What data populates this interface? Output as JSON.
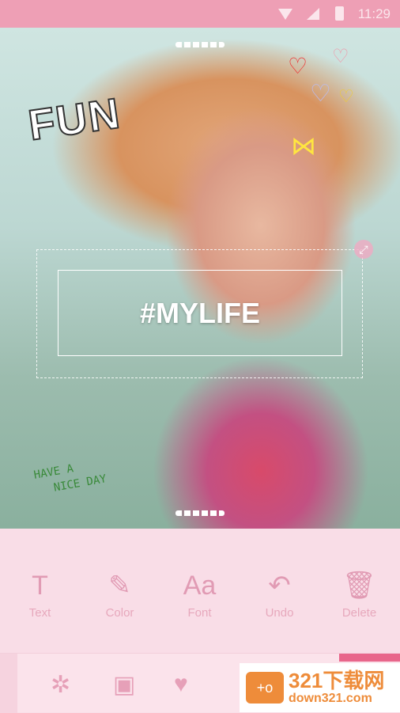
{
  "status_bar": {
    "time": "11:29",
    "icons": [
      "wifi-icon",
      "signal-icon",
      "battery-icon"
    ]
  },
  "canvas": {
    "text_overlay": "#MYLIFE",
    "sticker_fun": "FUN",
    "sticker_nice_day_line1": "HAVE A",
    "sticker_nice_day_line2": "NICE DAY"
  },
  "toolbar": {
    "items": [
      {
        "label": "Text",
        "icon": "text-icon",
        "glyph": "T"
      },
      {
        "label": "Color",
        "icon": "eyedropper-icon",
        "glyph": "✎"
      },
      {
        "label": "Font",
        "icon": "font-icon",
        "glyph": "Aa"
      },
      {
        "label": "Undo",
        "icon": "undo-icon",
        "glyph": "↶"
      },
      {
        "label": "Delete",
        "icon": "trash-icon",
        "glyph": "🗑"
      }
    ]
  },
  "bottom_bar": {
    "items": [
      {
        "icon": "aperture-icon",
        "glyph": "✲"
      },
      {
        "icon": "frame-icon",
        "glyph": "▣"
      },
      {
        "icon": "heart-icon",
        "glyph": "♥"
      }
    ],
    "accent": "#e8668b"
  },
  "watermark": {
    "title": "321下载网",
    "url": "down321.com"
  }
}
